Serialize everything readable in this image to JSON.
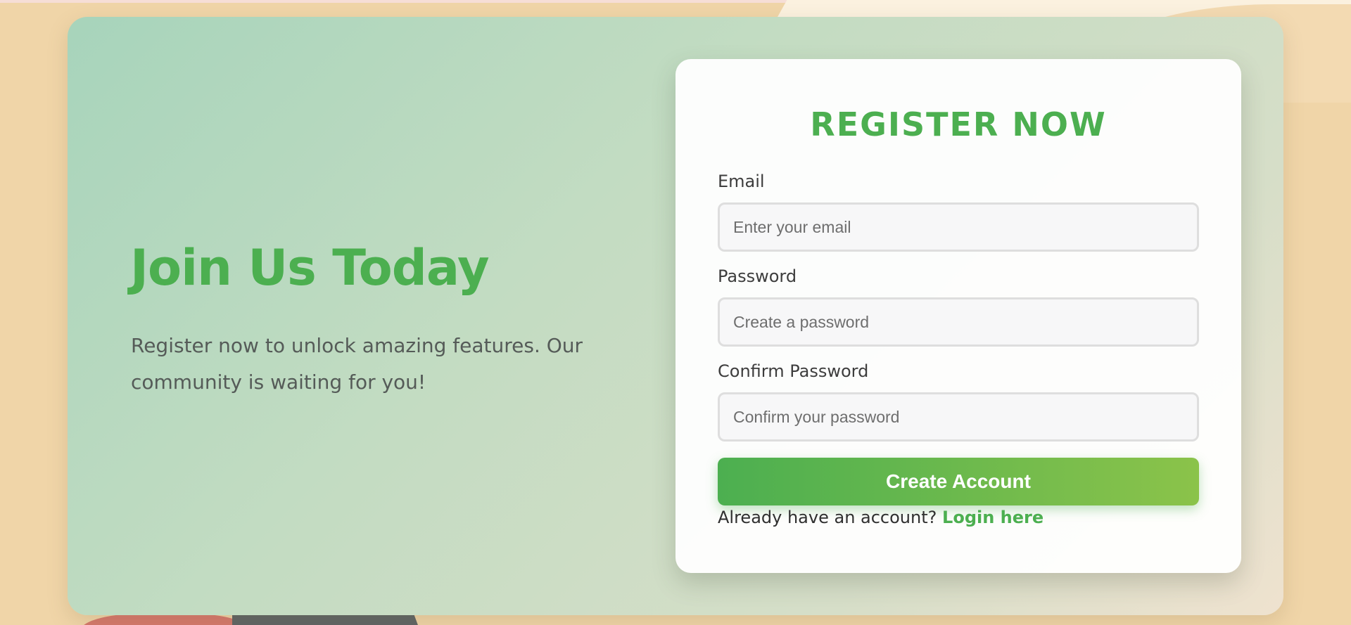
{
  "colors": {
    "accent": "#4caf50",
    "accent_end": "#8bc34a",
    "page_background": "#f0d5a8",
    "card_gradient_start": "#a7d4bb"
  },
  "hero": {
    "title": "Join Us Today",
    "subtitle": "Register now to unlock amazing features. Our community is waiting for you!"
  },
  "form": {
    "title": "REGISTER NOW",
    "email": {
      "label": "Email",
      "value": "",
      "placeholder": "Enter your email"
    },
    "password": {
      "label": "Password",
      "value": "",
      "placeholder": "Create a password"
    },
    "confirm_password": {
      "label": "Confirm Password",
      "value": "",
      "placeholder": "Confirm your password"
    },
    "submit_label": "Create Account",
    "login_prompt": "Already have an account?",
    "login_link": "Login here"
  }
}
